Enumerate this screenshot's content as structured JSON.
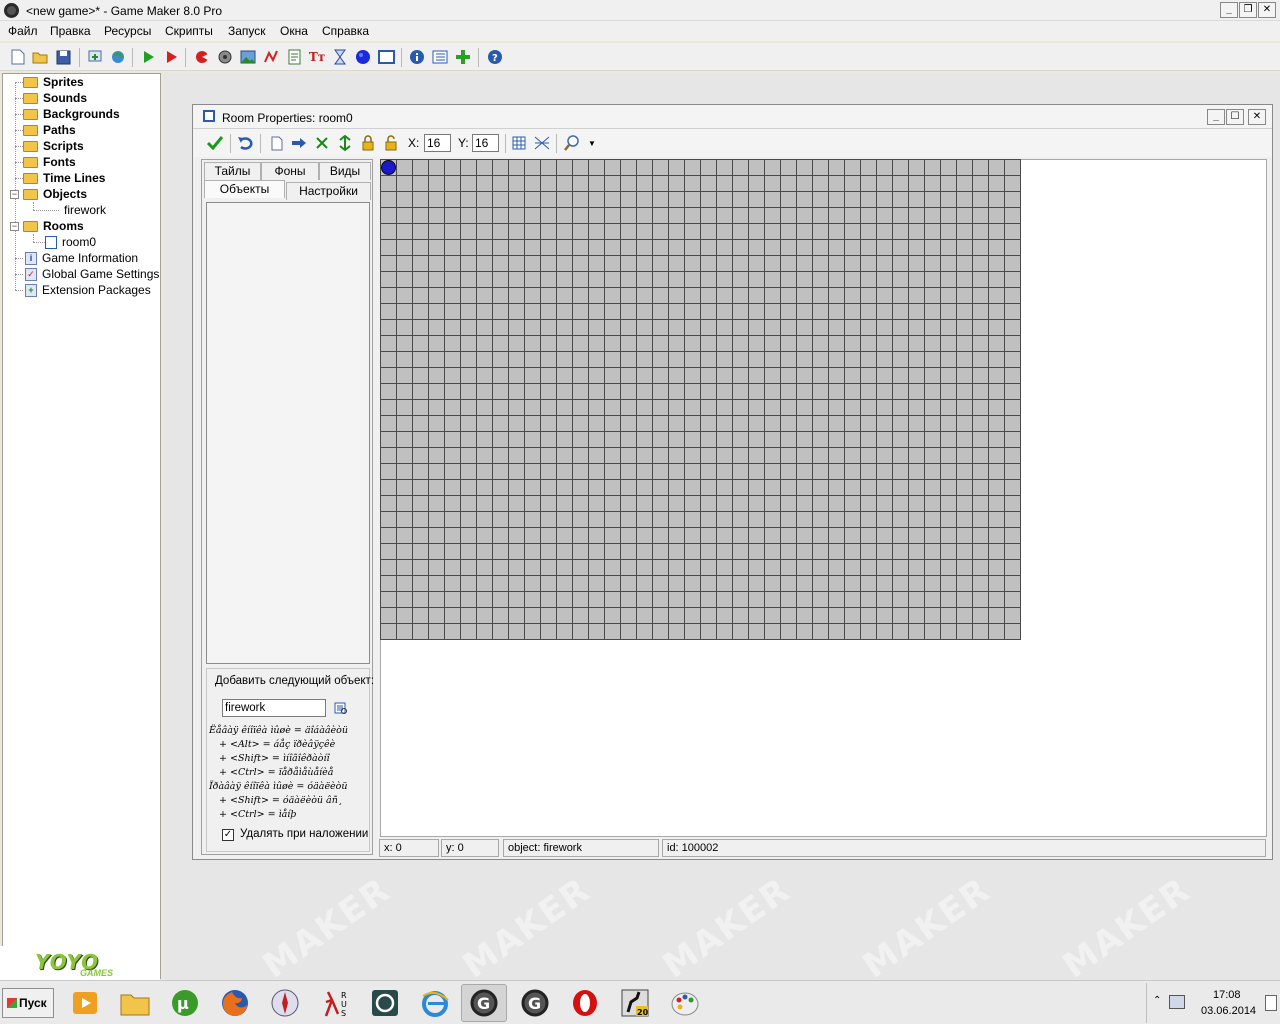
{
  "window": {
    "title": "<new game>* - Game Maker 8.0 Pro"
  },
  "menu": [
    "Файл",
    "Правка",
    "Ресурсы",
    "Скрипты",
    "Запуск",
    "Окна",
    "Справка"
  ],
  "tree": {
    "sprites": "Sprites",
    "sounds": "Sounds",
    "backgrounds": "Backgrounds",
    "paths": "Paths",
    "scripts": "Scripts",
    "fonts": "Fonts",
    "timelines": "Time Lines",
    "objects": "Objects",
    "object_firework": "firework",
    "rooms": "Rooms",
    "room0": "room0",
    "game_info": "Game Information",
    "global_settings": "Global Game Settings",
    "extension_packages": "Extension Packages"
  },
  "brand": {
    "logo": "YOYO",
    "sub": "GAMES"
  },
  "watermark": "MAKER",
  "room": {
    "title": "Room Properties: room0",
    "snap_x_label": "X:",
    "snap_x": "16",
    "snap_y_label": "Y:",
    "snap_y": "16",
    "tabs_row1": [
      "Тайлы",
      "Фоны",
      "Виды"
    ],
    "tabs_row2": [
      "Объекты",
      "Настройки"
    ],
    "add_object_label": "Добавить следующий объект:",
    "selected_object": "firework",
    "hints": [
      "Ëåâàÿ êíîïêà ìûøè = äîáàâèòü",
      "+ <Alt> = áåç ïðèâÿçêè",
      "+ <Shift> = ìíîãîêðàòíî",
      "+ <Ctrl> = ïåðåìåùåíèå",
      "Ïðàâàÿ êíîïêà ìûøè = óäàëèòü",
      "+ <Shift> = óäàëèòü âñ¸",
      "+ <Ctrl> = ìåíþ"
    ],
    "delete_underlying_label": "Удалять при наложении",
    "delete_underlying_checked": true,
    "status": {
      "x": "x: 0",
      "y": "y: 0",
      "object": "object: firework",
      "id": "id: 100002"
    }
  },
  "taskbar": {
    "start_label": "Пуск",
    "time": "17:08",
    "date": "03.06.2014"
  },
  "colors": {
    "grid_bg": "#c0c0c0",
    "grid_line": "#4a4a4a",
    "instance": "#1a1acc",
    "folder": "#f3c44a",
    "logo_green": "#8bc43f"
  }
}
